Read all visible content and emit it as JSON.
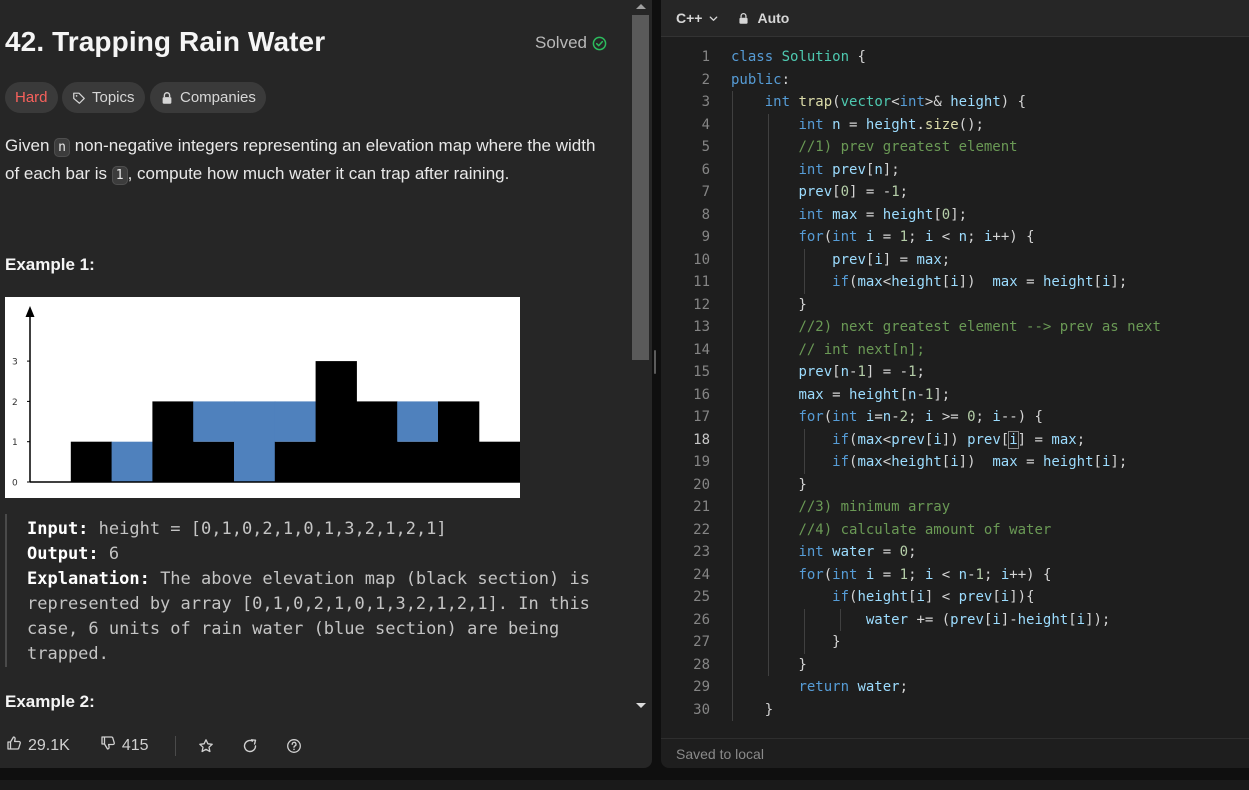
{
  "problem": {
    "title": "42. Trapping Rain Water",
    "status": "Solved",
    "difficulty": "Hard",
    "topics_label": "Topics",
    "companies_label": "Companies",
    "description": {
      "part1": "Given ",
      "code_n": "n",
      "part2": " non-negative integers representing an elevation map where the width of each bar is ",
      "code_1": "1",
      "part3": ", compute how much water it can trap after raining."
    },
    "example1": {
      "title": "Example 1:",
      "input_label": "Input:",
      "input_value": " height = [0,1,0,2,1,0,1,3,2,1,2,1]",
      "output_label": "Output:",
      "output_value": " 6",
      "explanation_label": "Explanation:",
      "explanation_value": " The above elevation map (black section) is represented by array [0,1,0,2,1,0,1,3,2,1,2,1]. In this case, 6 units of rain water (blue section) are being trapped."
    },
    "example2_title": "Example 2:",
    "elevation_map": {
      "heights": [
        0,
        1,
        0,
        2,
        1,
        0,
        1,
        3,
        2,
        1,
        2,
        1
      ],
      "water": [
        0,
        0,
        1,
        0,
        1,
        2,
        1,
        0,
        0,
        1,
        0,
        0
      ],
      "y_ticks": [
        "0",
        "1",
        "2",
        "3"
      ],
      "bar_color": "#000000",
      "water_color": "#4f81bd"
    }
  },
  "footer": {
    "likes": "29.1K",
    "dislikes": "415"
  },
  "editor": {
    "language": "C++",
    "mode": "Auto",
    "status": "Saved to local",
    "active_line": 18
  },
  "colors": {
    "accent_green": "#2cbb5d",
    "hard_red": "#f8615c"
  }
}
